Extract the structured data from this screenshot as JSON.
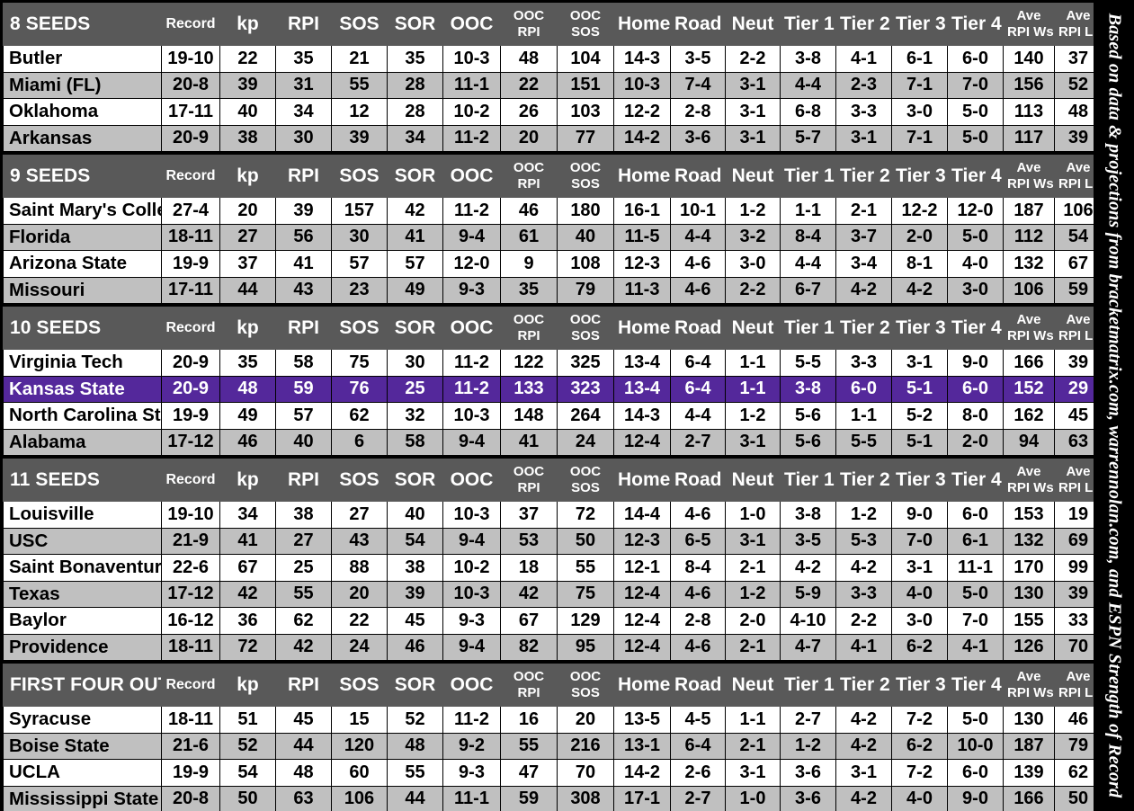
{
  "credit": "Based on data & projections from bracketmatrix.com, warrennolan.com, and ESPN Strength of Record",
  "colors": {
    "header_bg": "#595959",
    "header_text": "#FFFFFF",
    "row_bg": "#FFFFFF",
    "row_alt_bg": "#C0C0C0",
    "highlight_bg": "#54289B",
    "highlight_text": "#FFFFFF",
    "page_bg": "#000000"
  },
  "columns": {
    "team": "",
    "record": "Record",
    "kp": "kp",
    "rpi": "RPI",
    "sos": "SOS",
    "sor": "SOR",
    "ooc": "OOC",
    "ooc_rpi_l1": "OOC",
    "ooc_rpi_l2": "RPI",
    "ooc_sos_l1": "OOC",
    "ooc_sos_l2": "SOS",
    "home": "Home",
    "road": "Road",
    "neut": "Neut",
    "tier1": "Tier 1",
    "tier2": "Tier 2",
    "tier3": "Tier 3",
    "tier4": "Tier 4",
    "ave_rpi_ws_l1": "Ave",
    "ave_rpi_ws_l2": "RPI Ws",
    "ave_rpi_ls_l1": "Ave",
    "ave_rpi_ls_l2": "RPI Ls"
  },
  "sections": [
    {
      "title": "8 SEEDS",
      "rows": [
        {
          "team": "Butler",
          "record": "19-10",
          "kp": "22",
          "rpi": "35",
          "sos": "21",
          "sor": "35",
          "ooc": "10-3",
          "ooc_rpi": "48",
          "ooc_sos": "104",
          "home": "14-3",
          "road": "3-5",
          "neut": "2-2",
          "tier1": "3-8",
          "tier2": "4-1",
          "tier3": "6-1",
          "tier4": "6-0",
          "ave_rpi_ws": "140",
          "ave_rpi_ls": "37",
          "highlight": false
        },
        {
          "team": "Miami (FL)",
          "record": "20-8",
          "kp": "39",
          "rpi": "31",
          "sos": "55",
          "sor": "28",
          "ooc": "11-1",
          "ooc_rpi": "22",
          "ooc_sos": "151",
          "home": "10-3",
          "road": "7-4",
          "neut": "3-1",
          "tier1": "4-4",
          "tier2": "2-3",
          "tier3": "7-1",
          "tier4": "7-0",
          "ave_rpi_ws": "156",
          "ave_rpi_ls": "52",
          "highlight": false
        },
        {
          "team": "Oklahoma",
          "record": "17-11",
          "kp": "40",
          "rpi": "34",
          "sos": "12",
          "sor": "28",
          "ooc": "10-2",
          "ooc_rpi": "26",
          "ooc_sos": "103",
          "home": "12-2",
          "road": "2-8",
          "neut": "3-1",
          "tier1": "6-8",
          "tier2": "3-3",
          "tier3": "3-0",
          "tier4": "5-0",
          "ave_rpi_ws": "113",
          "ave_rpi_ls": "48",
          "highlight": false
        },
        {
          "team": "Arkansas",
          "record": "20-9",
          "kp": "38",
          "rpi": "30",
          "sos": "39",
          "sor": "34",
          "ooc": "11-2",
          "ooc_rpi": "20",
          "ooc_sos": "77",
          "home": "14-2",
          "road": "3-6",
          "neut": "3-1",
          "tier1": "5-7",
          "tier2": "3-1",
          "tier3": "7-1",
          "tier4": "5-0",
          "ave_rpi_ws": "117",
          "ave_rpi_ls": "39",
          "highlight": false
        }
      ]
    },
    {
      "title": "9 SEEDS",
      "rows": [
        {
          "team": "Saint Mary's College",
          "record": "27-4",
          "kp": "20",
          "rpi": "39",
          "sos": "157",
          "sor": "42",
          "ooc": "11-2",
          "ooc_rpi": "46",
          "ooc_sos": "180",
          "home": "16-1",
          "road": "10-1",
          "neut": "1-2",
          "tier1": "1-1",
          "tier2": "2-1",
          "tier3": "12-2",
          "tier4": "12-0",
          "ave_rpi_ws": "187",
          "ave_rpi_ls": "106",
          "highlight": false
        },
        {
          "team": "Florida",
          "record": "18-11",
          "kp": "27",
          "rpi": "56",
          "sos": "30",
          "sor": "41",
          "ooc": "9-4",
          "ooc_rpi": "61",
          "ooc_sos": "40",
          "home": "11-5",
          "road": "4-4",
          "neut": "3-2",
          "tier1": "8-4",
          "tier2": "3-7",
          "tier3": "2-0",
          "tier4": "5-0",
          "ave_rpi_ws": "112",
          "ave_rpi_ls": "54",
          "highlight": false
        },
        {
          "team": "Arizona State",
          "record": "19-9",
          "kp": "37",
          "rpi": "41",
          "sos": "57",
          "sor": "57",
          "ooc": "12-0",
          "ooc_rpi": "9",
          "ooc_sos": "108",
          "home": "12-3",
          "road": "4-6",
          "neut": "3-0",
          "tier1": "4-4",
          "tier2": "3-4",
          "tier3": "8-1",
          "tier4": "4-0",
          "ave_rpi_ws": "132",
          "ave_rpi_ls": "67",
          "highlight": false
        },
        {
          "team": "Missouri",
          "record": "17-11",
          "kp": "44",
          "rpi": "43",
          "sos": "23",
          "sor": "49",
          "ooc": "9-3",
          "ooc_rpi": "35",
          "ooc_sos": "79",
          "home": "11-3",
          "road": "4-6",
          "neut": "2-2",
          "tier1": "6-7",
          "tier2": "4-2",
          "tier3": "4-2",
          "tier4": "3-0",
          "ave_rpi_ws": "106",
          "ave_rpi_ls": "59",
          "highlight": false
        }
      ]
    },
    {
      "title": "10 SEEDS",
      "rows": [
        {
          "team": "Virginia Tech",
          "record": "20-9",
          "kp": "35",
          "rpi": "58",
          "sos": "75",
          "sor": "30",
          "ooc": "11-2",
          "ooc_rpi": "122",
          "ooc_sos": "325",
          "home": "13-4",
          "road": "6-4",
          "neut": "1-1",
          "tier1": "5-5",
          "tier2": "3-3",
          "tier3": "3-1",
          "tier4": "9-0",
          "ave_rpi_ws": "166",
          "ave_rpi_ls": "39",
          "highlight": false
        },
        {
          "team": "Kansas State",
          "record": "20-9",
          "kp": "48",
          "rpi": "59",
          "sos": "76",
          "sor": "25",
          "ooc": "11-2",
          "ooc_rpi": "133",
          "ooc_sos": "323",
          "home": "13-4",
          "road": "6-4",
          "neut": "1-1",
          "tier1": "3-8",
          "tier2": "6-0",
          "tier3": "5-1",
          "tier4": "6-0",
          "ave_rpi_ws": "152",
          "ave_rpi_ls": "29",
          "highlight": true
        },
        {
          "team": "North Carolina State",
          "record": "19-9",
          "kp": "49",
          "rpi": "57",
          "sos": "62",
          "sor": "32",
          "ooc": "10-3",
          "ooc_rpi": "148",
          "ooc_sos": "264",
          "home": "14-3",
          "road": "4-4",
          "neut": "1-2",
          "tier1": "5-6",
          "tier2": "1-1",
          "tier3": "5-2",
          "tier4": "8-0",
          "ave_rpi_ws": "162",
          "ave_rpi_ls": "45",
          "highlight": false
        },
        {
          "team": "Alabama",
          "record": "17-12",
          "kp": "46",
          "rpi": "40",
          "sos": "6",
          "sor": "58",
          "ooc": "9-4",
          "ooc_rpi": "41",
          "ooc_sos": "24",
          "home": "12-4",
          "road": "2-7",
          "neut": "3-1",
          "tier1": "5-6",
          "tier2": "5-5",
          "tier3": "5-1",
          "tier4": "2-0",
          "ave_rpi_ws": "94",
          "ave_rpi_ls": "63",
          "highlight": false
        }
      ]
    },
    {
      "title": "11 SEEDS",
      "rows": [
        {
          "team": "Louisville",
          "record": "19-10",
          "kp": "34",
          "rpi": "38",
          "sos": "27",
          "sor": "40",
          "ooc": "10-3",
          "ooc_rpi": "37",
          "ooc_sos": "72",
          "home": "14-4",
          "road": "4-6",
          "neut": "1-0",
          "tier1": "3-8",
          "tier2": "1-2",
          "tier3": "9-0",
          "tier4": "6-0",
          "ave_rpi_ws": "153",
          "ave_rpi_ls": "19",
          "highlight": false
        },
        {
          "team": "USC",
          "record": "21-9",
          "kp": "41",
          "rpi": "27",
          "sos": "43",
          "sor": "54",
          "ooc": "9-4",
          "ooc_rpi": "53",
          "ooc_sos": "50",
          "home": "12-3",
          "road": "6-5",
          "neut": "3-1",
          "tier1": "3-5",
          "tier2": "5-3",
          "tier3": "7-0",
          "tier4": "6-1",
          "ave_rpi_ws": "132",
          "ave_rpi_ls": "69",
          "highlight": false
        },
        {
          "team": "Saint Bonaventure",
          "record": "22-6",
          "kp": "67",
          "rpi": "25",
          "sos": "88",
          "sor": "38",
          "ooc": "10-2",
          "ooc_rpi": "18",
          "ooc_sos": "55",
          "home": "12-1",
          "road": "8-4",
          "neut": "2-1",
          "tier1": "4-2",
          "tier2": "4-2",
          "tier3": "3-1",
          "tier4": "11-1",
          "ave_rpi_ws": "170",
          "ave_rpi_ls": "99",
          "highlight": false
        },
        {
          "team": "Texas",
          "record": "17-12",
          "kp": "42",
          "rpi": "55",
          "sos": "20",
          "sor": "39",
          "ooc": "10-3",
          "ooc_rpi": "42",
          "ooc_sos": "75",
          "home": "12-4",
          "road": "4-6",
          "neut": "1-2",
          "tier1": "5-9",
          "tier2": "3-3",
          "tier3": "4-0",
          "tier4": "5-0",
          "ave_rpi_ws": "130",
          "ave_rpi_ls": "39",
          "highlight": false
        },
        {
          "team": "Baylor",
          "record": "16-12",
          "kp": "36",
          "rpi": "62",
          "sos": "22",
          "sor": "45",
          "ooc": "9-3",
          "ooc_rpi": "67",
          "ooc_sos": "129",
          "home": "12-4",
          "road": "2-8",
          "neut": "2-0",
          "tier1": "4-10",
          "tier2": "2-2",
          "tier3": "3-0",
          "tier4": "7-0",
          "ave_rpi_ws": "155",
          "ave_rpi_ls": "33",
          "highlight": false
        },
        {
          "team": "Providence",
          "record": "18-11",
          "kp": "72",
          "rpi": "42",
          "sos": "24",
          "sor": "46",
          "ooc": "9-4",
          "ooc_rpi": "82",
          "ooc_sos": "95",
          "home": "12-4",
          "road": "4-6",
          "neut": "2-1",
          "tier1": "4-7",
          "tier2": "4-1",
          "tier3": "6-2",
          "tier4": "4-1",
          "ave_rpi_ws": "126",
          "ave_rpi_ls": "70",
          "highlight": false
        }
      ]
    },
    {
      "title": "FIRST FOUR OUT",
      "rows": [
        {
          "team": "Syracuse",
          "record": "18-11",
          "kp": "51",
          "rpi": "45",
          "sos": "15",
          "sor": "52",
          "ooc": "11-2",
          "ooc_rpi": "16",
          "ooc_sos": "20",
          "home": "13-5",
          "road": "4-5",
          "neut": "1-1",
          "tier1": "2-7",
          "tier2": "4-2",
          "tier3": "7-2",
          "tier4": "5-0",
          "ave_rpi_ws": "130",
          "ave_rpi_ls": "46",
          "highlight": false
        },
        {
          "team": "Boise State",
          "record": "21-6",
          "kp": "52",
          "rpi": "44",
          "sos": "120",
          "sor": "48",
          "ooc": "9-2",
          "ooc_rpi": "55",
          "ooc_sos": "216",
          "home": "13-1",
          "road": "6-4",
          "neut": "2-1",
          "tier1": "1-2",
          "tier2": "4-2",
          "tier3": "6-2",
          "tier4": "10-0",
          "ave_rpi_ws": "187",
          "ave_rpi_ls": "79",
          "highlight": false
        },
        {
          "team": "UCLA",
          "record": "19-9",
          "kp": "54",
          "rpi": "48",
          "sos": "60",
          "sor": "55",
          "ooc": "9-3",
          "ooc_rpi": "47",
          "ooc_sos": "70",
          "home": "14-2",
          "road": "2-6",
          "neut": "3-1",
          "tier1": "3-6",
          "tier2": "3-1",
          "tier3": "7-2",
          "tier4": "6-0",
          "ave_rpi_ws": "139",
          "ave_rpi_ls": "62",
          "highlight": false
        },
        {
          "team": "Mississippi State",
          "record": "20-8",
          "kp": "50",
          "rpi": "63",
          "sos": "106",
          "sor": "44",
          "ooc": "11-1",
          "ooc_rpi": "59",
          "ooc_sos": "308",
          "home": "17-1",
          "road": "2-7",
          "neut": "1-0",
          "tier1": "3-6",
          "tier2": "4-2",
          "tier3": "4-0",
          "tier4": "9-0",
          "ave_rpi_ws": "166",
          "ave_rpi_ls": "50",
          "highlight": false
        }
      ]
    }
  ]
}
